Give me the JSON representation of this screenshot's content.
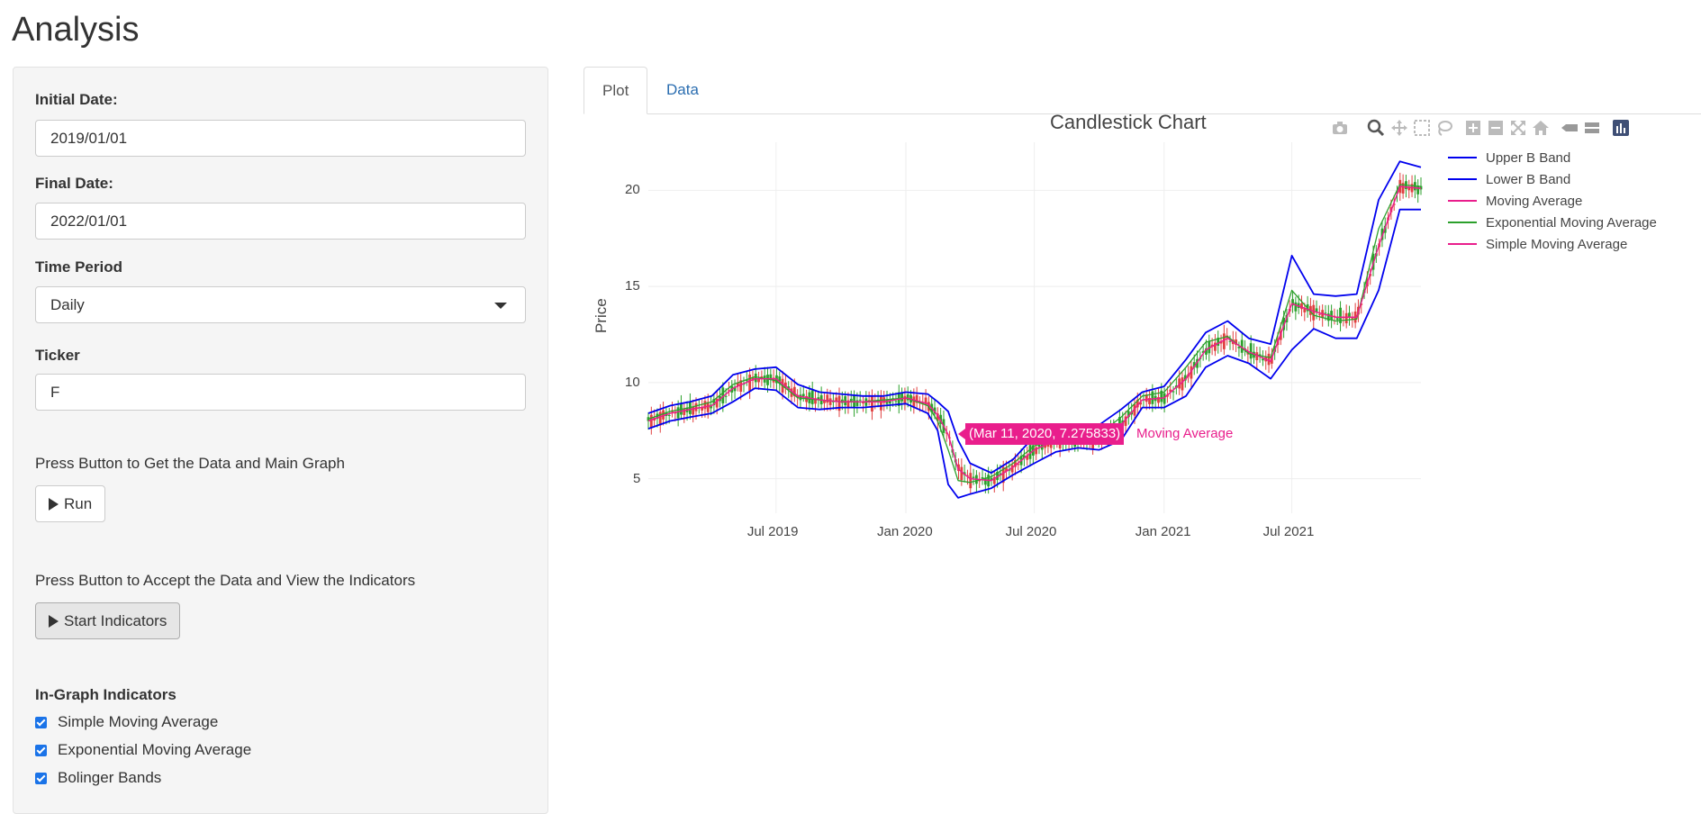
{
  "app": {
    "title": "Analysis"
  },
  "sidebar": {
    "initial_date": {
      "label": "Initial Date:",
      "value": "2019/01/01"
    },
    "final_date": {
      "label": "Final Date:",
      "value": "2022/01/01"
    },
    "time_period": {
      "label": "Time Period",
      "selected": "Daily"
    },
    "ticker": {
      "label": "Ticker",
      "value": "F"
    },
    "run_help": "Press Button to Get the Data and Main Graph",
    "run_label": "Run",
    "indicators_help": "Press Button to Accept the Data and View the Indicators",
    "indicators_label": "Start Indicators",
    "in_graph": {
      "title": "In-Graph Indicators",
      "items": [
        {
          "label": "Simple Moving Average",
          "checked": true
        },
        {
          "label": "Exponential Moving Average",
          "checked": true
        },
        {
          "label": "Bolinger Bands",
          "checked": true
        }
      ]
    }
  },
  "tabs": [
    {
      "label": "Plot",
      "active": true
    },
    {
      "label": "Data",
      "active": false
    }
  ],
  "modebar_icons": [
    "camera-icon",
    "zoom-icon",
    "pan-icon",
    "box-select-icon",
    "lasso-icon",
    "zoom-in-icon",
    "zoom-out-icon",
    "autoscale-icon",
    "reset-axes-icon",
    "spike-lines-icon",
    "compare-data-icon",
    "plotly-logo-icon"
  ],
  "chart_data": {
    "type": "line",
    "title": "Candlestick Chart",
    "ylabel": "Price",
    "xlabel": "",
    "x_ticks": [
      "Jul 2019",
      "Jan 2020",
      "Jul 2020",
      "Jan 2021",
      "Jul 2021"
    ],
    "y_ticks": [
      5,
      10,
      15,
      20
    ],
    "ylim": [
      3.2,
      22.5
    ],
    "xlim": [
      "2019-01-01",
      "2021-12-31"
    ],
    "grid": true,
    "legend_position": "top-right",
    "x": [
      "2019-01-01",
      "2019-02-01",
      "2019-03-01",
      "2019-04-01",
      "2019-05-01",
      "2019-06-01",
      "2019-07-01",
      "2019-08-01",
      "2019-09-01",
      "2019-10-01",
      "2019-11-01",
      "2019-12-01",
      "2020-01-01",
      "2020-02-01",
      "2020-02-15",
      "2020-03-01",
      "2020-03-15",
      "2020-04-01",
      "2020-05-01",
      "2020-06-01",
      "2020-07-01",
      "2020-08-01",
      "2020-09-01",
      "2020-10-01",
      "2020-11-01",
      "2020-12-01",
      "2021-01-01",
      "2021-02-01",
      "2021-03-01",
      "2021-04-01",
      "2021-05-01",
      "2021-06-01",
      "2021-07-01",
      "2021-08-01",
      "2021-09-01",
      "2021-10-01",
      "2021-11-01",
      "2021-12-01",
      "2021-12-31"
    ],
    "series": [
      {
        "name": "Upper B Band",
        "color": "#0000ee",
        "values": [
          8.4,
          8.8,
          9.0,
          9.3,
          10.4,
          10.7,
          10.8,
          9.9,
          9.5,
          9.4,
          9.3,
          9.3,
          9.5,
          9.4,
          9.0,
          8.5,
          7.0,
          5.8,
          5.3,
          6.0,
          7.2,
          7.6,
          7.4,
          7.8,
          8.6,
          9.5,
          9.8,
          11.2,
          12.6,
          13.2,
          12.3,
          12.0,
          16.6,
          14.6,
          14.5,
          14.6,
          19.5,
          21.5,
          21.2
        ]
      },
      {
        "name": "Lower B Band",
        "color": "#0000ee",
        "values": [
          7.6,
          8.0,
          8.2,
          8.4,
          9.0,
          9.7,
          9.6,
          8.7,
          8.6,
          8.7,
          8.7,
          8.8,
          8.9,
          8.4,
          7.5,
          4.7,
          4.0,
          4.2,
          4.5,
          5.2,
          5.8,
          6.4,
          6.6,
          6.5,
          7.0,
          8.7,
          8.7,
          9.3,
          10.8,
          11.4,
          11.0,
          10.2,
          11.7,
          12.8,
          12.3,
          12.3,
          14.8,
          19.0,
          19.0
        ]
      },
      {
        "name": "Moving Average",
        "color": "#e91e8c",
        "values": [
          8.0,
          8.4,
          8.6,
          8.8,
          9.7,
          10.2,
          10.2,
          9.3,
          9.1,
          9.0,
          9.0,
          9.0,
          9.2,
          8.9,
          8.3,
          7.3,
          5.5,
          5.0,
          4.9,
          5.6,
          6.5,
          7.0,
          7.0,
          7.1,
          7.8,
          9.1,
          9.2,
          10.2,
          11.7,
          12.3,
          11.6,
          11.1,
          14.1,
          13.7,
          13.4,
          13.4,
          17.1,
          20.2,
          20.1
        ]
      },
      {
        "name": "Exponential Moving Average",
        "color": "#2ca02c",
        "values": [
          8.1,
          8.5,
          8.7,
          9.0,
          9.9,
          10.3,
          10.1,
          9.2,
          9.1,
          9.0,
          9.0,
          9.1,
          9.2,
          8.8,
          8.0,
          6.5,
          4.9,
          4.8,
          5.1,
          5.8,
          6.7,
          7.1,
          7.0,
          7.3,
          8.2,
          9.3,
          9.5,
          10.8,
          12.1,
          12.4,
          11.5,
          11.3,
          14.8,
          13.5,
          13.2,
          13.3,
          18.0,
          20.3,
          20.2
        ]
      },
      {
        "name": "Simple Moving Average",
        "color": "#e91e8c",
        "values": [
          8.0,
          8.4,
          8.6,
          8.8,
          9.7,
          10.2,
          10.2,
          9.3,
          9.1,
          9.0,
          9.0,
          9.0,
          9.2,
          8.9,
          8.3,
          7.3,
          5.5,
          5.0,
          4.9,
          5.6,
          6.5,
          7.0,
          7.0,
          7.1,
          7.8,
          9.1,
          9.2,
          10.2,
          11.7,
          12.3,
          11.6,
          11.1,
          14.1,
          13.7,
          13.4,
          13.4,
          17.1,
          20.2,
          20.1
        ]
      }
    ],
    "candles": {
      "up_color": "#2ca02c",
      "down_color": "#e04040"
    },
    "hover": {
      "text": "(Mar 11, 2020, 7.275833)",
      "series": "Moving Average",
      "x": "2020-03-11",
      "y": 7.275833
    }
  }
}
